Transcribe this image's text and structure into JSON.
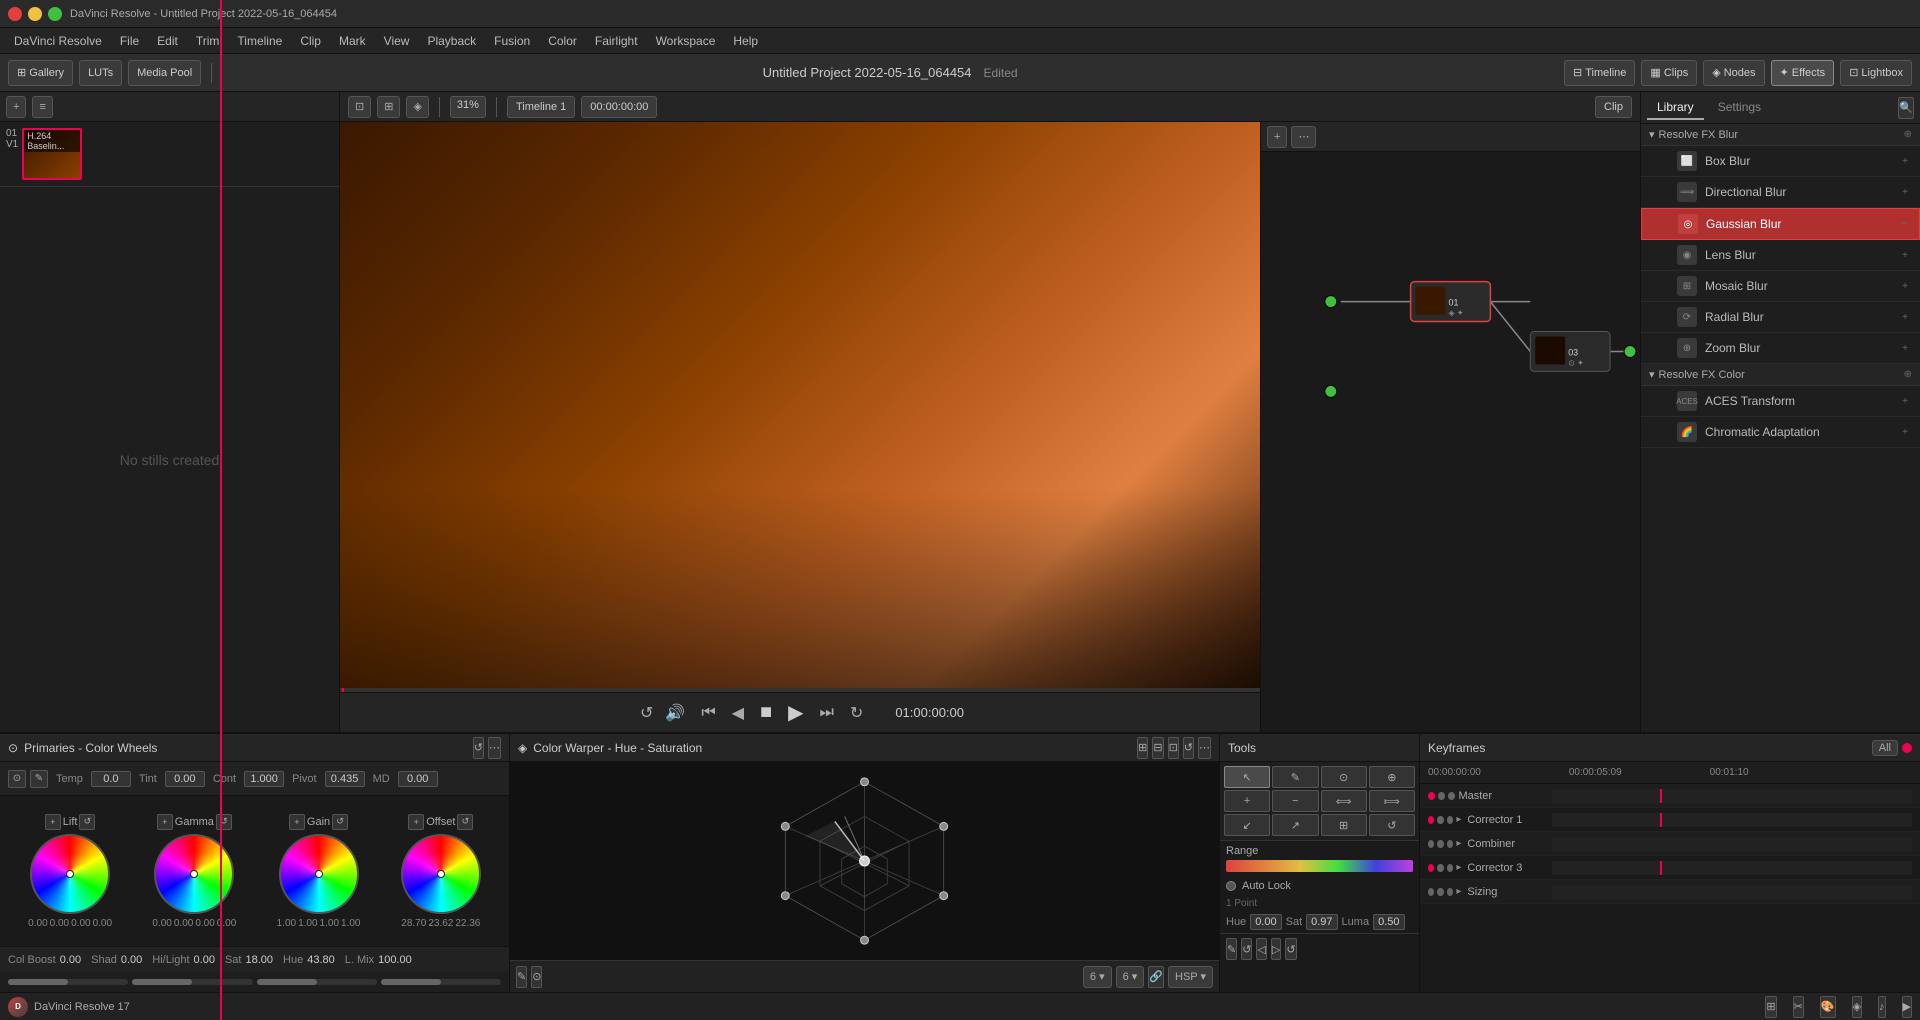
{
  "app": {
    "title": "DaVinci Resolve - Untitled Project 2022-05-16_064454",
    "logo": "DaVinci Resolve",
    "version": "DaVinci Resolve 17"
  },
  "titlebar": {
    "title": "DaVinci Resolve - Untitled Project 2022-05-16_064454"
  },
  "menubar": {
    "items": [
      "DaVinci Resolve",
      "File",
      "Edit",
      "Trim",
      "Timeline",
      "Clip",
      "Mark",
      "View",
      "Playback",
      "Fusion",
      "Color",
      "Fairlight",
      "Workspace",
      "Help"
    ]
  },
  "project": {
    "name": "Untitled Project 2022-05-16_064454",
    "status": "Edited"
  },
  "viewer": {
    "zoom": "31%",
    "timeline_name": "Timeline 1",
    "timecode": "00:00:00:00",
    "clip_label": "Clip",
    "playback_time": "01:00:00:00"
  },
  "toolbar_top": {
    "gallery": "Gallery",
    "luts": "LUTs",
    "media_pool": "Media Pool",
    "timeline": "Timeline",
    "clips": "Clips",
    "nodes": "Nodes",
    "effects": "Effects",
    "lightbox": "Lightbox"
  },
  "left_panel": {
    "no_stills": "No stills created"
  },
  "color_wheels": {
    "title": "Primaries - Color Wheels",
    "temp_label": "Temp",
    "temp_value": "0.0",
    "tint_label": "Tint",
    "tint_value": "0.00",
    "cont_label": "Cont",
    "cont_value": "1.000",
    "pivot_label": "Pivot",
    "pivot_value": "0.435",
    "md_label": "MD",
    "md_value": "0.00",
    "wheels": [
      {
        "label": "Lift",
        "values": [
          "0.00",
          "0.00",
          "0.00",
          "0.00"
        ],
        "dot_x": "50%",
        "dot_y": "50%"
      },
      {
        "label": "Gamma",
        "values": [
          "0.00",
          "0.00",
          "0.00",
          "0.00"
        ],
        "dot_x": "50%",
        "dot_y": "50%"
      },
      {
        "label": "Gain",
        "values": [
          "1.00",
          "1.00",
          "1.00",
          "1.00"
        ],
        "dot_x": "50%",
        "dot_y": "50%"
      },
      {
        "label": "Offset",
        "values": [
          "28.70",
          "23.62",
          "22.36"
        ],
        "dot_x": "50%",
        "dot_y": "50%"
      }
    ],
    "bottom_params": {
      "col_boost_label": "Col Boost",
      "col_boost_value": "0.00",
      "shad_label": "Shad",
      "shad_value": "0.00",
      "hilight_label": "Hi/Light",
      "hilight_value": "0.00",
      "sat_label": "Sat",
      "sat_value": "18.00",
      "hue_label": "Hue",
      "hue_value": "43.80",
      "lmix_label": "L. Mix",
      "lmix_value": "100.00"
    }
  },
  "color_warper": {
    "title": "Color Warper - Hue - Saturation"
  },
  "tools": {
    "title": "Tools",
    "range_label": "Range",
    "auto_lock_label": "Auto Lock",
    "point_label": "1 Point",
    "hue_label": "Hue",
    "hue_value": "0.00",
    "sat_label": "Sat",
    "sat_value": "0.97",
    "luma_label": "Luma",
    "luma_value": "0.50"
  },
  "keyframes": {
    "title": "Keyframes",
    "all_label": "All",
    "timecodes": [
      "00:00:00:00",
      "00:00:05:09",
      "00:01:10"
    ],
    "tracks": [
      {
        "name": "Master",
        "has_marker": true
      },
      {
        "name": "Corrector 1",
        "has_marker": true
      },
      {
        "name": "Combiner",
        "has_marker": false
      },
      {
        "name": "Corrector 3",
        "has_marker": true
      },
      {
        "name": "Sizing",
        "has_marker": false
      }
    ]
  },
  "effects_library": {
    "library_tab": "Library",
    "settings_tab": "Settings",
    "resolve_fx_blur_title": "Resolve FX Blur",
    "resolve_fx_color_title": "Resolve FX Color",
    "blur_effects": [
      {
        "name": "Box Blur",
        "active": false
      },
      {
        "name": "Directional Blur",
        "active": false
      },
      {
        "name": "Gaussian Blur",
        "active": true
      },
      {
        "name": "Lens Blur",
        "active": false
      },
      {
        "name": "Mosaic Blur",
        "active": false
      },
      {
        "name": "Radial Blur",
        "active": false
      },
      {
        "name": "Zoom Blur",
        "active": false
      }
    ],
    "color_effects": [
      {
        "name": "ACES Transform",
        "active": false
      },
      {
        "name": "Chromatic Adaptation",
        "active": false
      }
    ]
  },
  "timeline_clip": {
    "label_01": "01",
    "label_v1": "V1",
    "clip_name": "H.264 Baselin..."
  }
}
